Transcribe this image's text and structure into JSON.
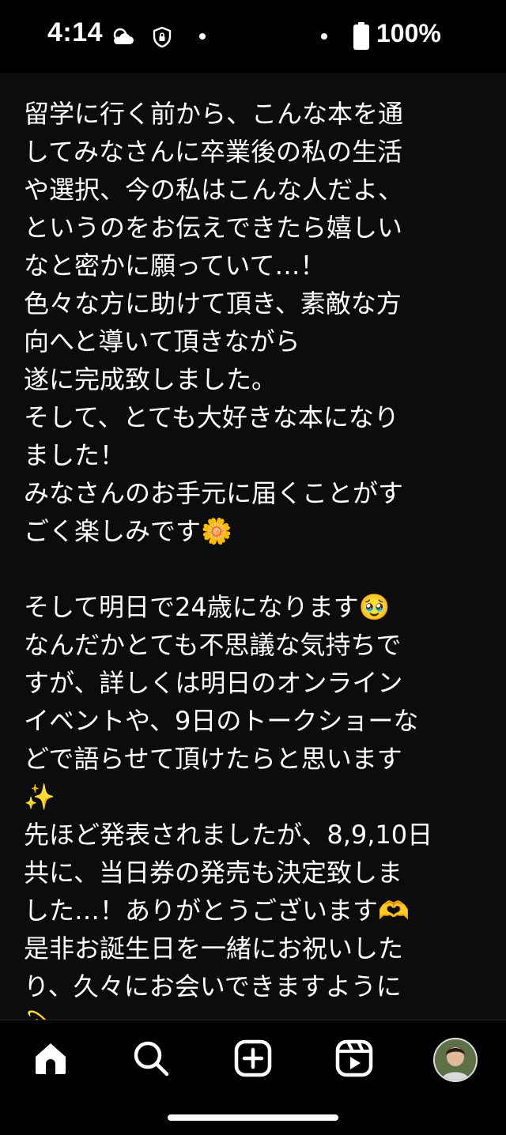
{
  "status_bar": {
    "time": "4:14",
    "battery": "100%",
    "icons": [
      "weather-cloud-sun-icon",
      "vpn-shield-icon",
      "battery-full-icon"
    ]
  },
  "caption": {
    "lines": [
      "留学に行く前から、こんな本を通",
      "してみなさんに卒業後の私の生活",
      "や選択、今の私はこんな人だよ、",
      "というのをお伝えできたら嬉しい",
      "なと密かに願っていて…！",
      "色々な方に助けて頂き、素敵な方",
      "向へと導いて頂きながら",
      "遂に完成致しました。",
      "そして、とても大好きな本になり",
      "ました！",
      "みなさんのお手元に届くことがす",
      "ごく楽しみです🌼",
      "",
      "そして明日で24歳になります🥹",
      "なんだかとても不思議な気持ちで",
      "すが、詳しくは明日のオンライン",
      "イベントや、9日のトークショーな",
      "どで語らせて頂けたらと思います",
      "✨",
      "先ほど発表されましたが、8,9,10日",
      "共に、当日券の発売も決定致しま",
      "した…！ありがとうございます🫶",
      "是非お誕生日を一緒にお祝いした",
      "り、久々にお会いできますように",
      "💫"
    ]
  },
  "bottom_nav": {
    "items": [
      "home-icon",
      "search-icon",
      "create-post-icon",
      "reels-icon",
      "profile-avatar"
    ]
  },
  "colors": {
    "background": "#0c0c0c",
    "text": "#ffffff",
    "bar": "#000000"
  }
}
